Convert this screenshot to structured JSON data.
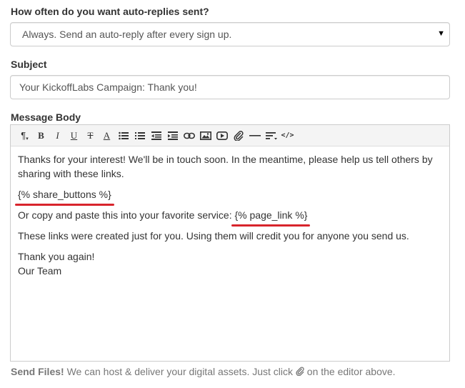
{
  "frequency": {
    "label": "How often do you want auto-replies sent?",
    "selected": "Always. Send an auto-reply after every sign up.",
    "caret": "▼"
  },
  "subject": {
    "label": "Subject",
    "value": "Your KickoffLabs Campaign: Thank you!"
  },
  "message": {
    "label": "Message Body",
    "toolbar": [
      "paragraph-icon",
      "bold-icon",
      "italic-icon",
      "underline-icon",
      "strikethrough-icon",
      "font-color-icon",
      "unordered-list-icon",
      "ordered-list-icon",
      "outdent-icon",
      "indent-icon",
      "link-icon",
      "image-icon",
      "video-icon",
      "attachment-icon",
      "horizontal-rule-icon",
      "align-icon",
      "html-icon"
    ],
    "body": {
      "intro": "Thanks for your interest! We'll be in touch soon. In the meantime, please help us tell others by sharing with these links.",
      "share_tag": "{% share_buttons %}",
      "copy_text": "Or copy and paste this into your favorite service: ",
      "link_tag": "{% page_link %}",
      "credit": "These links were created just for you. Using them will credit you for anyone you send us.",
      "thanks": "Thank you again!",
      "signoff": "Our Team"
    },
    "highlight_color": "#d8242c"
  },
  "help": {
    "bold": "Send Files!",
    "text_before": " We can host & deliver your digital assets. Just click ",
    "text_after": " on the editor above."
  }
}
